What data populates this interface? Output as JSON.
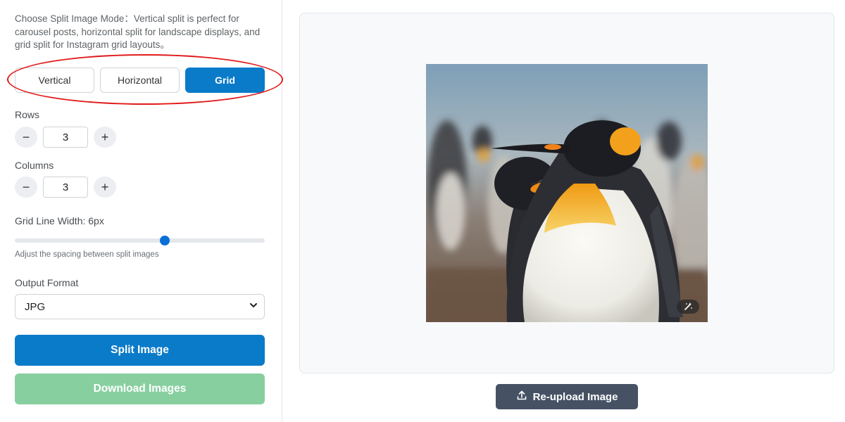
{
  "panel": {
    "mode_description": "Choose Split Image Mode：Vertical split is perfect for carousel posts, horizontal split for landscape displays, and grid split for Instagram grid layouts。",
    "modes": [
      {
        "label": "Vertical",
        "active": false
      },
      {
        "label": "Horizontal",
        "active": false
      },
      {
        "label": "Grid",
        "active": true
      }
    ],
    "rows": {
      "label": "Rows",
      "value": "3",
      "minus": "−",
      "plus": "+"
    },
    "columns": {
      "label": "Columns",
      "value": "3",
      "minus": "−",
      "plus": "+"
    },
    "grid_line": {
      "label": "Grid Line Width: 6px",
      "value_fraction": 0.6,
      "hint": "Adjust the spacing between split images"
    },
    "output_format": {
      "label": "Output Format",
      "selected": "JPG"
    },
    "split_label": "Split Image",
    "download_label": "Download Images"
  },
  "preview": {
    "reupload_label": "Re-upload Image"
  },
  "colors": {
    "accent": "#0a7bc9",
    "download_disabled": "#88cfa0",
    "annotation_red": "#e11b1b",
    "reupload_bg": "#465264"
  }
}
